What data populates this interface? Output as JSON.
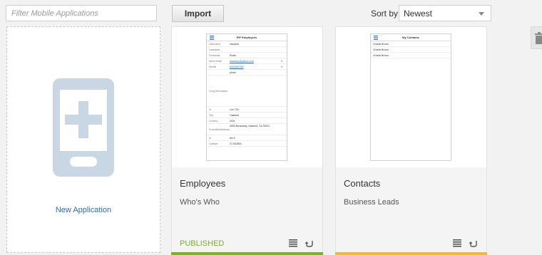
{
  "toolbar": {
    "filter_placeholder": "Filter Mobile Applications",
    "import_label": "Import",
    "sort_label": "Sort by",
    "sort_value": "Newest"
  },
  "new_application": {
    "label": "New Application"
  },
  "apps": [
    {
      "name": "Employees",
      "description": "Who's Who",
      "status": "PUBLISHED",
      "status_color": "#7bb02c",
      "bar_color": "#7bb02c",
      "thumb": {
        "title": "PIF Employees",
        "fields": [
          {
            "key": "Username",
            "value": "rdawson"
          },
          {
            "key": "Lastname",
            "value": ""
          },
          {
            "key": "Firstname",
            "value": "Rosie"
          },
          {
            "key": "Work Email",
            "value": "rdawson@yahoo.com"
          },
          {
            "key": "Mobile",
            "value": "6002667000"
          },
          {
            "key": "",
            "value": "photo"
          },
          {
            "key": "Long Description",
            "value": ""
          },
          {
            "key": "Id",
            "value": "Lee 733"
          },
          {
            "key": "City",
            "value": "Oakland"
          },
          {
            "key": "Country",
            "value": "USA"
          },
          {
            "key": "FormattedAddress",
            "value": "4600 Broadway, Oakland, CA 94611"
          },
          {
            "key": "Id",
            "value": "lee 6"
          },
          {
            "key": "Latitude",
            "value": "37.832892"
          }
        ]
      }
    },
    {
      "name": "Contacts",
      "description": "Business Leads",
      "status": "",
      "status_color": "#7bb02c",
      "bar_color": "#f0b64a",
      "thumb": {
        "title": "My Contacts",
        "rows": [
          "Charlie Brown",
          "Charlie Brown",
          "Charlie Brown"
        ]
      }
    }
  ],
  "icons": {
    "new_app": "mobile-add-icon",
    "list": "list-icon",
    "redeploy": "return-arrow-icon",
    "trash": "trash-icon"
  }
}
